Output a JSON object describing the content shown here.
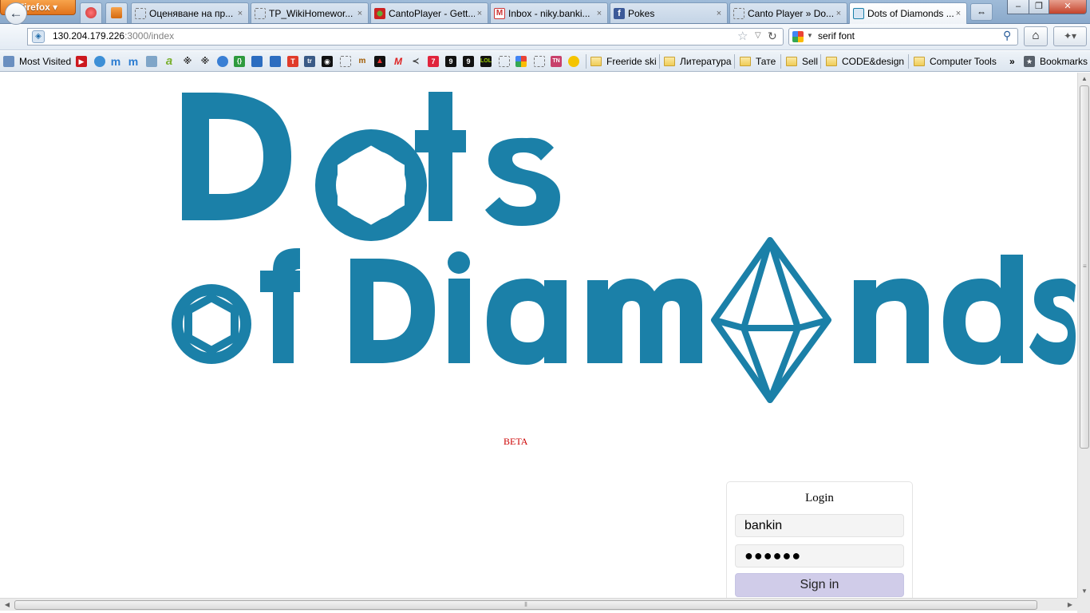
{
  "browser": {
    "menu_button": "Firefox",
    "tabs": [
      {
        "label": "Оценяване на пр...",
        "favicon": "blank-page-icon"
      },
      {
        "label": "TP_WikiHomewor...",
        "favicon": "blank-page-icon"
      },
      {
        "label": "CantoPlayer - Gett...",
        "favicon": "canto-icon"
      },
      {
        "label": "Inbox - niky.banki...",
        "favicon": "gmail-icon"
      },
      {
        "label": "Pokes",
        "favicon": "facebook-icon"
      },
      {
        "label": "Canto Player » Do...",
        "favicon": "blank-page-icon"
      },
      {
        "label": "Dots of Diamonds ...",
        "favicon": "site-icon",
        "active": true
      }
    ],
    "tab_close_glyph": "×",
    "tab_list_glyph": "⇔",
    "window_controls": {
      "minimize": "–",
      "maximize": "❐",
      "close": "✕"
    },
    "url": {
      "host": "130.204.179.226",
      "path": ":3000/index"
    },
    "search": {
      "engine": "google-icon",
      "value": "serif font"
    },
    "home_glyph": "⌂",
    "addon_glyph": "✦▾"
  },
  "bookmarks": {
    "most_visited": "Most Visited",
    "folders": [
      "Freeride ski",
      "Литература",
      "Тате",
      "Sell",
      "CODE&design",
      "Computer Tools"
    ],
    "overflow": "»",
    "bookmarks_menu": "Bookmarks",
    "icon_colors": {
      "youtube": "#cc181e",
      "brand": "#1b80a8"
    }
  },
  "page": {
    "logo_line1": "Dots",
    "logo_line2": "of Diamonds",
    "logo_color": "#1b80a8",
    "beta_label": "BETA",
    "beta_color": "#cc0000",
    "login": {
      "title": "Login",
      "username": "bankin",
      "password_mask": "●●●●●●",
      "submit": "Sign in",
      "submit_color": "#d0cce9"
    }
  }
}
